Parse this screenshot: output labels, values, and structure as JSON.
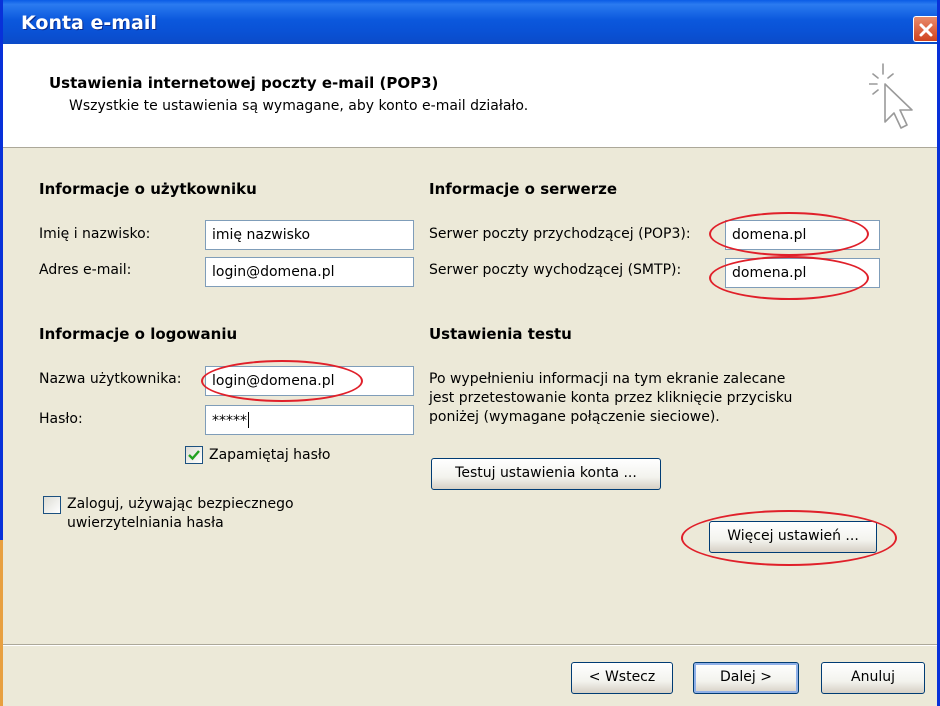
{
  "window": {
    "title": "Konta e-mail"
  },
  "header": {
    "title": "Ustawienia internetowej poczty e-mail (POP3)",
    "subtitle": "Wszystkie te ustawienia są wymagane, aby konto e-mail działało."
  },
  "user_info": {
    "section_title": "Informacje o użytkowniku",
    "name_label": "Imię i nazwisko:",
    "name_value": "imię nazwisko",
    "email_label": "Adres e-mail:",
    "email_value": "login@domena.pl"
  },
  "server_info": {
    "section_title": "Informacje o serwerze",
    "incoming_label": "Serwer poczty przychodzącej (POP3):",
    "incoming_value": "domena.pl",
    "outgoing_label": "Serwer poczty wychodzącej (SMTP):",
    "outgoing_value": "domena.pl"
  },
  "login_info": {
    "section_title": "Informacje o logowaniu",
    "username_label": "Nazwa użytkownika:",
    "username_value": "login@domena.pl",
    "password_label": "Hasło:",
    "password_value": "*****",
    "remember_label": "Zapamiętaj hasło",
    "remember_checked": true,
    "spa_label_line1": "Zaloguj, używając bezpiecznego",
    "spa_label_line2": "uwierzytelniania hasła",
    "spa_checked": false
  },
  "test_settings": {
    "section_title": "Ustawienia testu",
    "description_line1": "Po wypełnieniu informacji na tym ekranie zalecane",
    "description_line2": "jest przetestowanie konta przez kliknięcie przycisku",
    "description_line3": "poniżej (wymagane połączenie sieciowe).",
    "test_button": "Testuj ustawienia konta ...",
    "more_button": "Więcej ustawień ..."
  },
  "footer": {
    "back_button": "< Wstecz",
    "next_button": "Dalej >",
    "cancel_button": "Anuluj"
  },
  "colors": {
    "titlebar": "#0a52d6",
    "highlight_ellipse": "#e0202a",
    "dialog_bg": "#ece9d8"
  }
}
